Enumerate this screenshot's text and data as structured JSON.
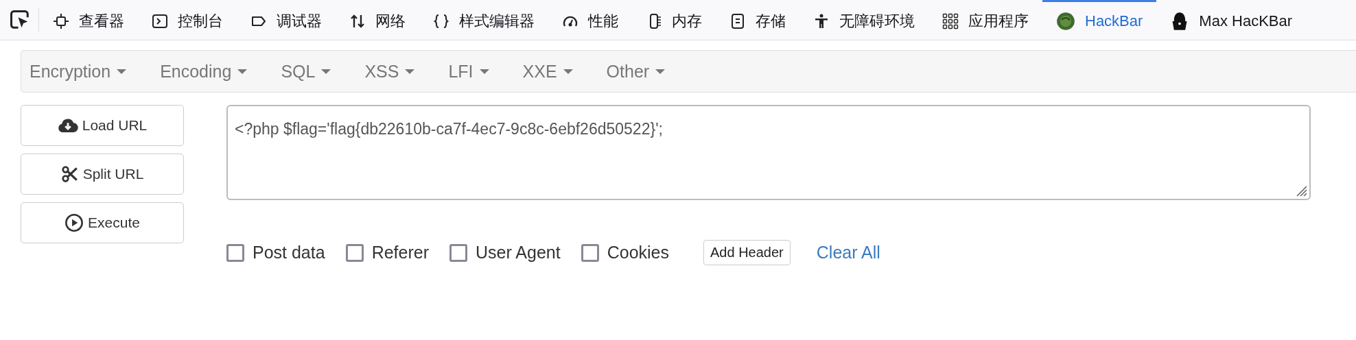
{
  "devtools_tabs": [
    {
      "label": "查看器",
      "selected": false
    },
    {
      "label": "控制台",
      "selected": false
    },
    {
      "label": "调试器",
      "selected": false
    },
    {
      "label": "网络",
      "selected": false
    },
    {
      "label": "样式编辑器",
      "selected": false
    },
    {
      "label": "性能",
      "selected": false
    },
    {
      "label": "内存",
      "selected": false
    },
    {
      "label": "存储",
      "selected": false
    },
    {
      "label": "无障碍环境",
      "selected": false
    },
    {
      "label": "应用程序",
      "selected": false
    },
    {
      "label": "HackBar",
      "selected": true
    },
    {
      "label": "Max HacKBar",
      "selected": false
    }
  ],
  "menu": [
    "Encryption",
    "Encoding",
    "SQL",
    "XSS",
    "LFI",
    "XXE",
    "Other"
  ],
  "buttons": [
    "Load URL",
    "Split URL",
    "Execute"
  ],
  "url_field": {
    "value": "<?php $flag='flag{db22610b-ca7f-4ec7-9c8c-6ebf26d50522}';"
  },
  "options": [
    {
      "label": "Post data",
      "checked": false
    },
    {
      "label": "Referer",
      "checked": false
    },
    {
      "label": "User Agent",
      "checked": false
    },
    {
      "label": "Cookies",
      "checked": false
    }
  ],
  "add_header": "Add Header",
  "clear_all": "Clear All"
}
